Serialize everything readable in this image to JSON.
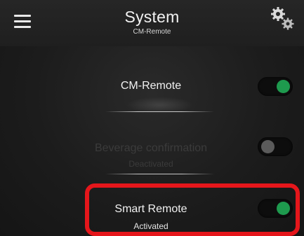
{
  "header": {
    "title": "System",
    "subtitle": "CM-Remote",
    "menu_icon": "hamburger-menu-icon",
    "settings_icon": "gears-icon"
  },
  "settings": [
    {
      "label": "CM-Remote",
      "status": "",
      "enabled": true,
      "toggle_on": true
    },
    {
      "label": "Beverage confirmation",
      "status": "Deactivated",
      "enabled": false,
      "toggle_on": false
    },
    {
      "label": "Smart Remote",
      "status": "Activated",
      "enabled": true,
      "toggle_on": true,
      "highlighted": true
    }
  ],
  "colors": {
    "toggle_on": "#1e9a4e",
    "toggle_off": "#5b5b5b",
    "highlight": "#e5161b",
    "background": "#1c1c1c"
  }
}
